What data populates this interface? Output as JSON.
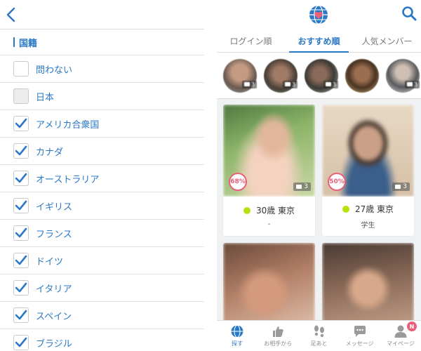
{
  "filter": {
    "section_title": "国籍",
    "options": [
      {
        "label": "問わない",
        "checked": false
      },
      {
        "label": "日本",
        "checked": false,
        "disabled": true
      },
      {
        "label": "アメリカ合衆国",
        "checked": true
      },
      {
        "label": "カナダ",
        "checked": true
      },
      {
        "label": "オーストラリア",
        "checked": true
      },
      {
        "label": "イギリス",
        "checked": true
      },
      {
        "label": "フランス",
        "checked": true
      },
      {
        "label": "ドイツ",
        "checked": true
      },
      {
        "label": "イタリア",
        "checked": true
      },
      {
        "label": "スペイン",
        "checked": true
      },
      {
        "label": "ブラジル",
        "checked": true
      }
    ]
  },
  "colors": {
    "accent": "#2a78c6",
    "match_pink": "#e8607a",
    "online_green": "#b8e10f"
  },
  "tabs": [
    {
      "label": "ログイン順",
      "active": false
    },
    {
      "label": "おすすめ順",
      "active": true
    },
    {
      "label": "人気メンバー",
      "active": false
    }
  ],
  "avatars": [
    {
      "count": "3"
    },
    {
      "count": "3"
    },
    {
      "count": "3"
    },
    {
      "count": ""
    },
    {
      "count": "3"
    }
  ],
  "cards": [
    {
      "match": "68%",
      "photos": "3",
      "age_location": "30歳 東京",
      "job": "-"
    },
    {
      "match": "50%",
      "photos": "3",
      "age_location": "27歳 東京",
      "job": "学生"
    },
    {
      "match": "",
      "photos": "",
      "age_location": "",
      "job": ""
    },
    {
      "match": "",
      "photos": "",
      "age_location": "",
      "job": ""
    }
  ],
  "nav": {
    "search": "探す",
    "likes": "お相手から",
    "footprints": "足あと",
    "messages": "メッセージ",
    "mypage": "マイページ",
    "mypage_badge": "N"
  }
}
